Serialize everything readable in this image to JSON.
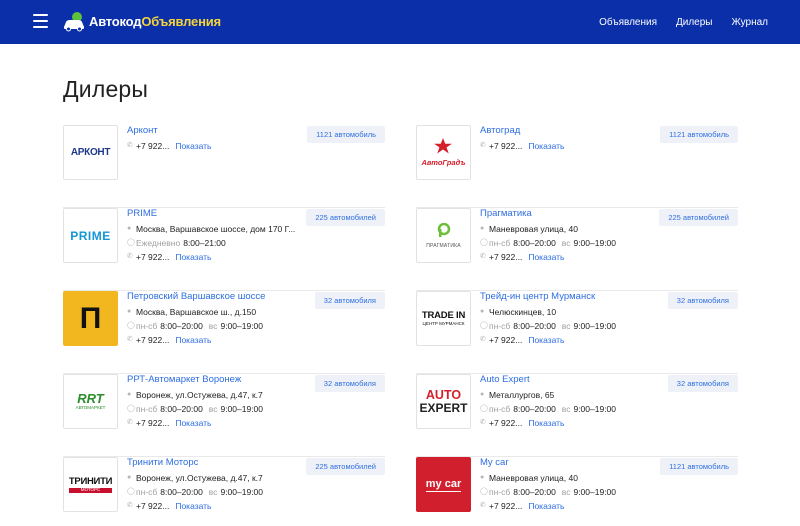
{
  "header": {
    "logo_part1": "Автокод",
    "logo_part2": "Объявления",
    "nav": [
      "Объявления",
      "Дилеры",
      "Журнал"
    ]
  },
  "page_title": "Дилеры",
  "show_label": "Показать",
  "dealers_left": [
    {
      "name": "Арконт",
      "badge": "1121 автомобиль",
      "phone": "+7 922...",
      "logo": "АРКОНТ"
    },
    {
      "name": "PRIME",
      "badge": "225 автомобилей",
      "address": "Москва, Варшавское шоссе, дом 170 Г...",
      "hours_label": "Ежедневно",
      "hours": "8:00–21:00",
      "phone": "+7 922...",
      "logo": "PRIME"
    },
    {
      "name": "Петровский Варшавское шоссе",
      "badge": "32 автомобиля",
      "address": "Москва, Варшавское ш., д.150",
      "weekdays_label": "пн-сб",
      "weekdays": "8:00–20:00",
      "sunday_label": "вс",
      "sunday": "9:00–19:00",
      "phone": "+7 922...",
      "logo": "П"
    },
    {
      "name": "РРТ-Автомаркет Воронеж",
      "badge": "32 автомобиля",
      "address": "Воронеж, ул.Остужева, д.47, к.7",
      "weekdays_label": "пн-сб",
      "weekdays": "8:00–20:00",
      "sunday_label": "вс",
      "sunday": "9:00–19:00",
      "phone": "+7 922...",
      "logo": "RRT",
      "logo_sub": "АВТОМАРКЕТ"
    },
    {
      "name": "Тринити Моторс",
      "badge": "225 автомобилей",
      "address": "Воронеж, ул.Остужева, д.47, к.7",
      "weekdays_label": "пн-сб",
      "weekdays": "8:00–20:00",
      "sunday_label": "вс",
      "sunday": "9:00–19:00",
      "phone": "+7 922...",
      "logo": "ТРИНИТИ",
      "logo_sub": "МОТОРС"
    }
  ],
  "dealers_right": [
    {
      "name": "Автоград",
      "badge": "1121 автомобиль",
      "phone": "+7 922...",
      "logo": "АвтоГрадъ"
    },
    {
      "name": "Прагматика",
      "badge": "225 автомобилей",
      "address": "Маневровая улица, 40",
      "weekdays_label": "пн-сб",
      "weekdays": "8:00–20:00",
      "sunday_label": "вс",
      "sunday": "9:00–19:00",
      "phone": "+7 922...",
      "logo": "ПРАГМАТИКА"
    },
    {
      "name": "Трейд-ин центр Мурманск",
      "badge": "32 автомобиля",
      "address": "Челюскинцев, 10",
      "weekdays_label": "пн-сб",
      "weekdays": "8:00–20:00",
      "sunday_label": "вс",
      "sunday": "9:00–19:00",
      "phone": "+7 922...",
      "logo": "TRADE IN",
      "logo_sub": "ЦЕНТР МУРМАНСК"
    },
    {
      "name": "Auto Expert",
      "badge": "32 автомобиля",
      "address": "Металлургов, 65",
      "weekdays_label": "пн-сб",
      "weekdays": "8:00–20:00",
      "sunday_label": "вс",
      "sunday": "9:00–19:00",
      "phone": "+7 922...",
      "logo": "AUTO",
      "logo_sub": "EXPERT"
    },
    {
      "name": "My car",
      "badge": "1121 автомобиль",
      "address": "Маневровая улица, 40",
      "weekdays_label": "пн-сб",
      "weekdays": "8:00–20:00",
      "sunday_label": "вс",
      "sunday": "9:00–19:00",
      "phone": "+7 922...",
      "logo": "my car"
    }
  ],
  "colors": {
    "header_bg": "#0a2fa8",
    "link": "#2e6ee0",
    "badge_bg": "#eef2f8",
    "logo_accent": "#f5d33a"
  }
}
